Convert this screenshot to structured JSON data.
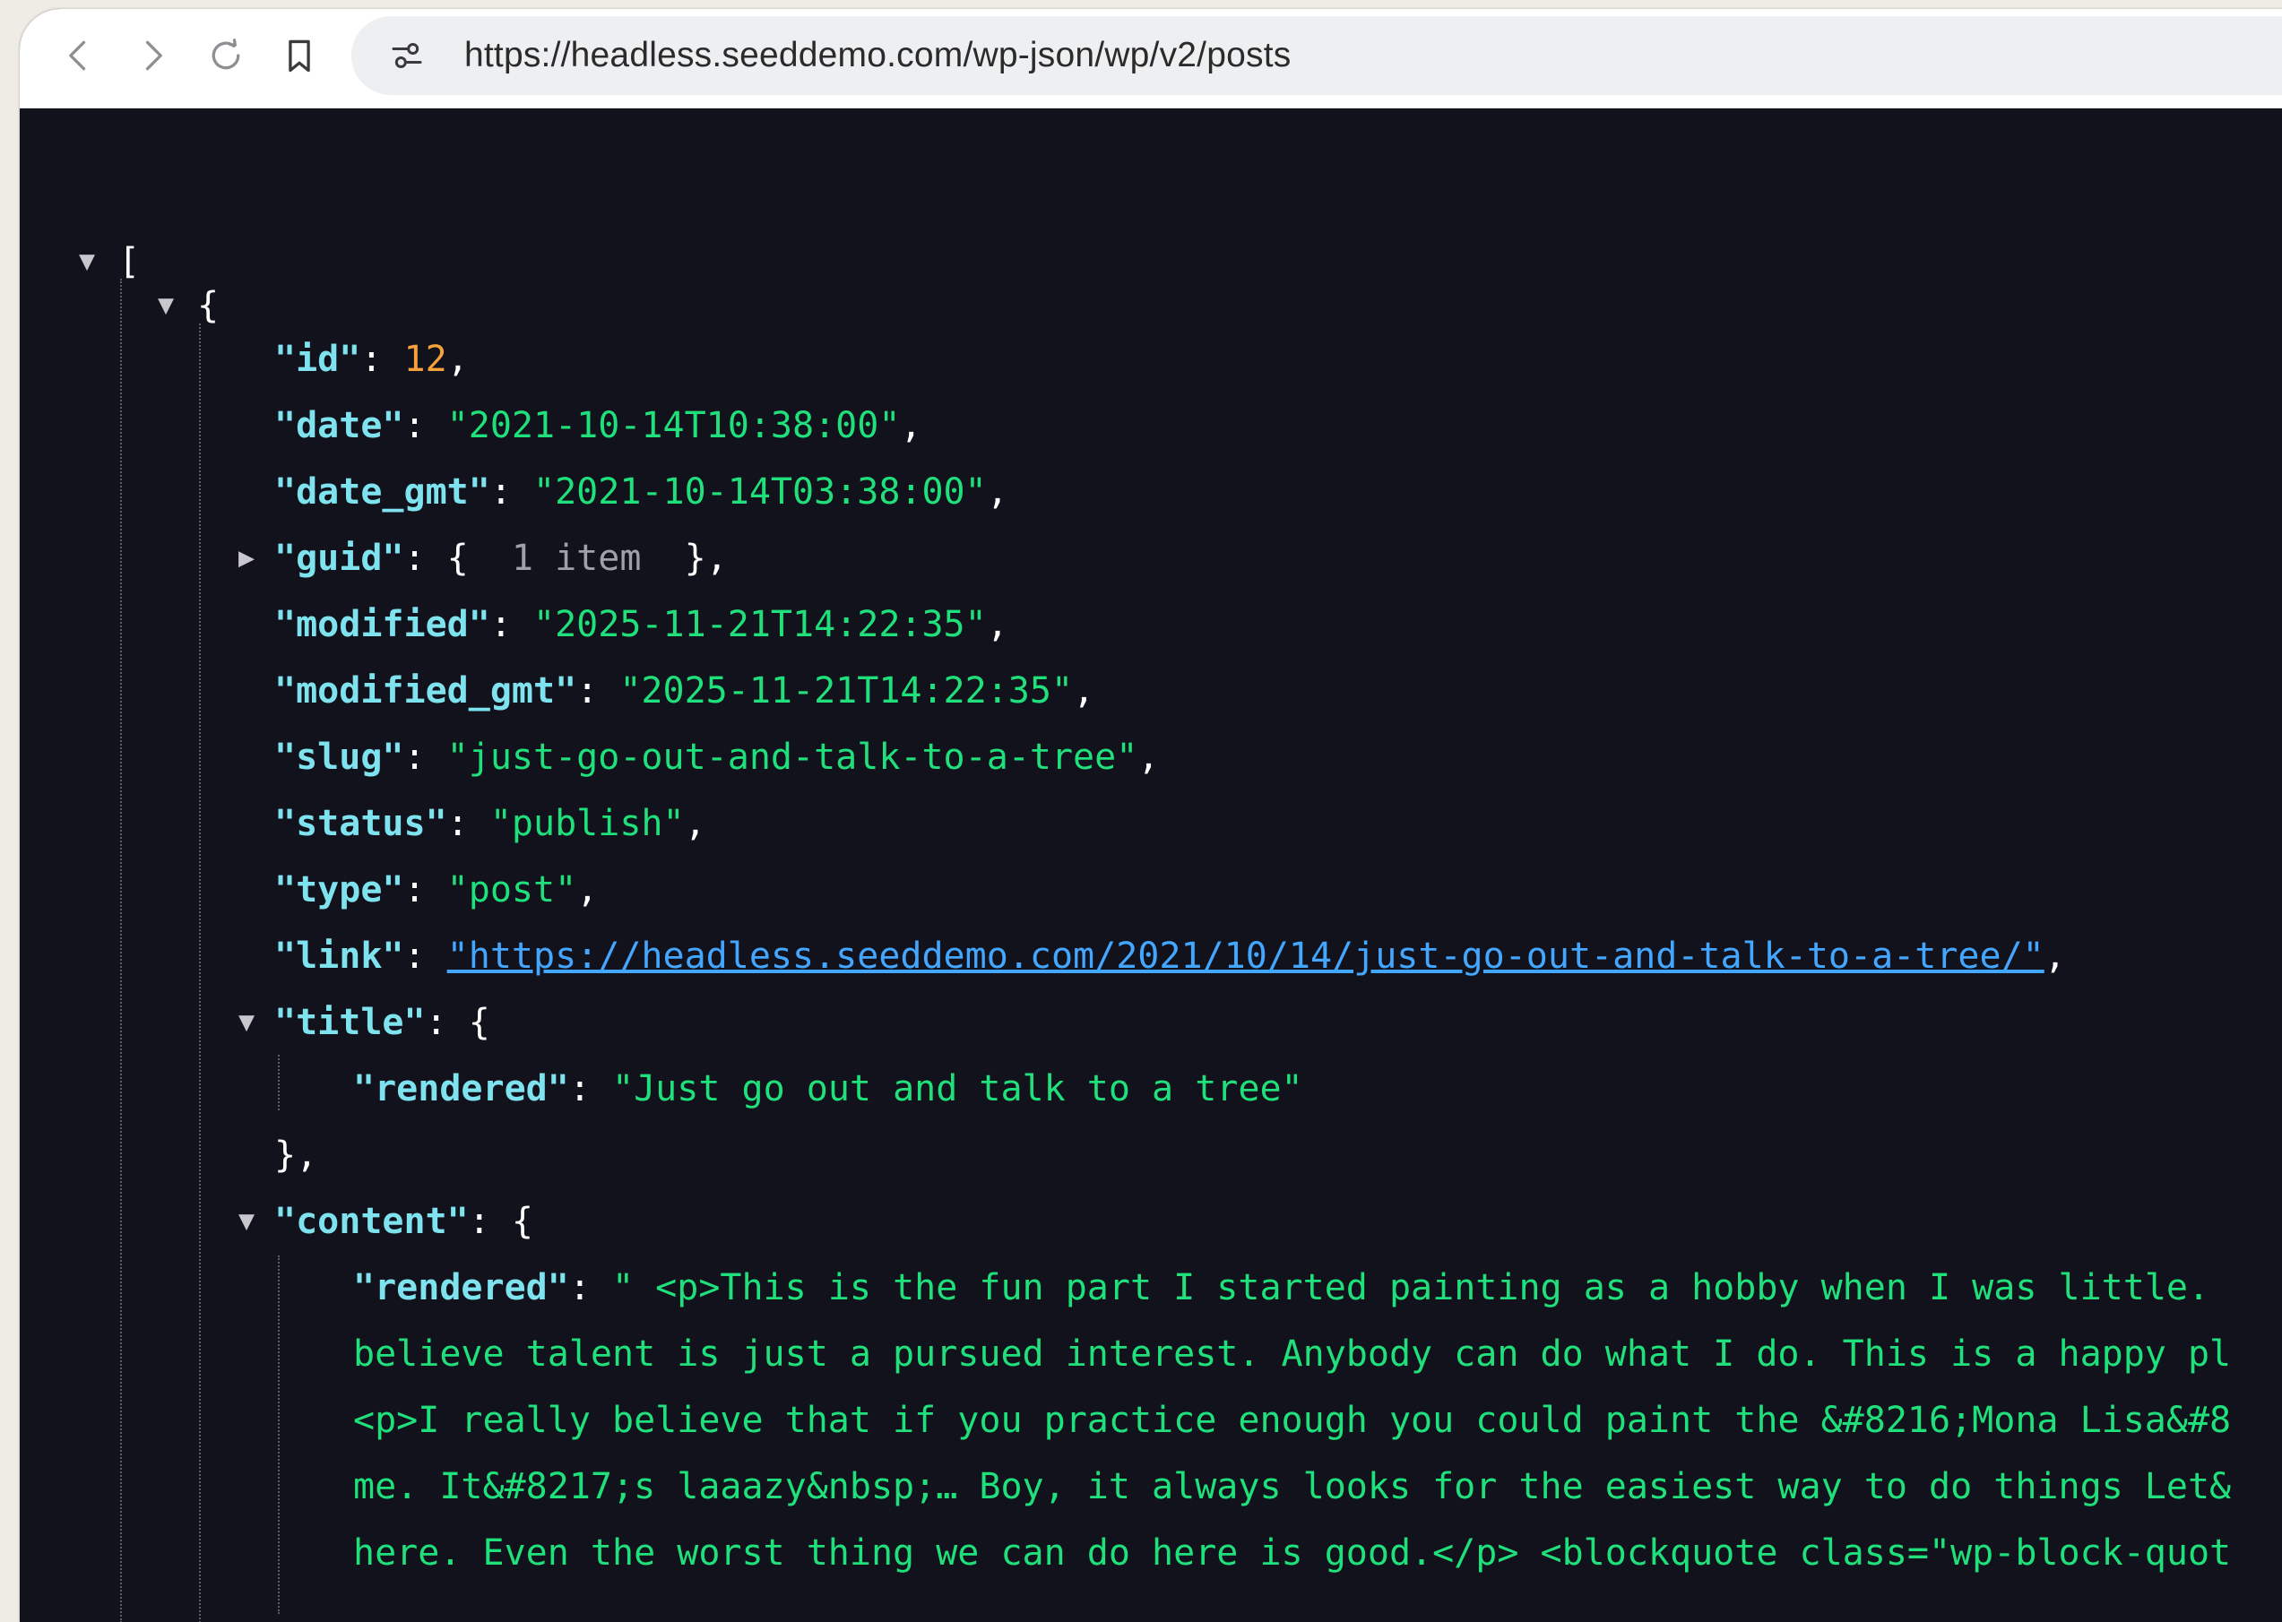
{
  "browser": {
    "url": "https://headless.seeddemo.com/wp-json/wp/v2/posts",
    "icons": [
      "chevron-left-icon",
      "chevron-right-icon",
      "reload-icon",
      "bookmark-icon",
      "tune-icon"
    ]
  },
  "json": {
    "open_bracket": "[",
    "open_brace": "{",
    "id": {
      "key": "\"id\"",
      "sep": ": ",
      "value": "12",
      "end": ","
    },
    "date": {
      "key": "\"date\"",
      "sep": ": ",
      "value": "\"2021-10-14T10:38:00\"",
      "end": ","
    },
    "date_gmt": {
      "key": "\"date_gmt\"",
      "sep": ": ",
      "value": "\"2021-10-14T03:38:00\"",
      "end": ","
    },
    "guid": {
      "key": "\"guid\"",
      "sep": ": ",
      "open": "{ ",
      "summary": " 1 item ",
      "close": " },"
    },
    "modified": {
      "key": "\"modified\"",
      "sep": ": ",
      "value": "\"2025-11-21T14:22:35\"",
      "end": ","
    },
    "modified_gmt": {
      "key": "\"modified_gmt\"",
      "sep": ": ",
      "value": "\"2025-11-21T14:22:35\"",
      "end": ","
    },
    "slug": {
      "key": "\"slug\"",
      "sep": ": ",
      "value": "\"just-go-out-and-talk-to-a-tree\"",
      "end": ","
    },
    "status": {
      "key": "\"status\"",
      "sep": ": ",
      "value": "\"publish\"",
      "end": ","
    },
    "type": {
      "key": "\"type\"",
      "sep": ": ",
      "value": "\"post\"",
      "end": ","
    },
    "link": {
      "key": "\"link\"",
      "sep": ": ",
      "value": "\"https://headless.seeddemo.com/2021/10/14/just-go-out-and-talk-to-a-tree/\"",
      "end": ","
    },
    "title": {
      "key": "\"title\"",
      "sep": ": ",
      "open": "{",
      "rendered_key": "\"rendered\"",
      "rendered_sep": ": ",
      "rendered_value": "\"Just go out and talk to a tree\"",
      "close": "},"
    },
    "content": {
      "key": "\"content\"",
      "sep": ": ",
      "open": "{",
      "rendered_key": "\"rendered\"",
      "rendered_sep": ": ",
      "lines": [
        "\" <p>This is the fun part I started painting as a hobby when I was little. ",
        "believe talent is just a pursued interest. Anybody can do what I do. This is a happy pl",
        "<p>I really believe that if you practice enough you could paint the &#8216;Mona Lisa&#8",
        "me. It&#8217;s laaazy&nbsp;… Boy, it always looks for the easiest way to do things Let&",
        "here. Even the worst thing we can do here is good.</p> <blockquote class=\"wp-block-quot"
      ]
    }
  }
}
